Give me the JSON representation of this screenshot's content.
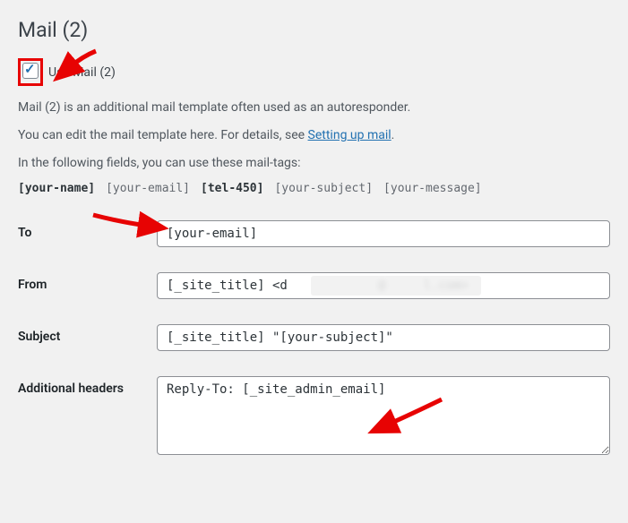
{
  "header": {
    "title": "Mail (2)"
  },
  "checkbox": {
    "checked": true,
    "label": "Use Mail (2)"
  },
  "descriptions": {
    "line1": "Mail (2) is an additional mail template often used as an autoresponder.",
    "line2_pre": "You can edit the mail template here. For details, see ",
    "line2_link": "Setting up mail",
    "line2_post": ".",
    "line3": "In the following fields, you can use these mail-tags:"
  },
  "mail_tags": [
    {
      "text": "[your-name]",
      "bold": true
    },
    {
      "text": "[your-email]",
      "bold": false
    },
    {
      "text": "[tel-450]",
      "bold": true
    },
    {
      "text": "[your-subject]",
      "bold": false
    },
    {
      "text": "[your-message]",
      "bold": false
    }
  ],
  "fields": {
    "to": {
      "label": "To",
      "value": "[your-email]"
    },
    "from": {
      "label": "From",
      "value": "[_site_title] <d            @     l.com>"
    },
    "subject": {
      "label": "Subject",
      "value": "[_site_title] \"[your-subject]\""
    },
    "additional_headers": {
      "label": "Additional headers",
      "value": "Reply-To: [_site_admin_email]"
    }
  }
}
